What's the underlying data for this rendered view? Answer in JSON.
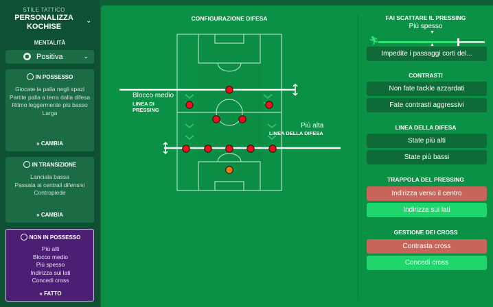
{
  "sidebar": {
    "style_label": "STILE TATTICO",
    "style_name": "PERSONALIZZA KOCHISE",
    "mentality_title": "MENTALITÀ",
    "mentality_value": "Positiva",
    "in_possession": {
      "title": "IN POSSESSO",
      "items": [
        "Giocate la palla negli spazi",
        "Partite palla a terra dalla difesa",
        "Ritmo leggermente più basso",
        "Larga"
      ],
      "button": "CAMBIA"
    },
    "in_transition": {
      "title": "IN TRANSIZIONE",
      "items": [
        "Lanciala bassa",
        "Passala ai centrali difensivi",
        "Contropiede"
      ],
      "button": "CAMBIA"
    },
    "out_of_possession": {
      "title": "NON IN POSSESSO",
      "items": [
        "Più alti",
        "Blocco medio",
        "Più spesso",
        "Indirizza sui lati",
        "Concedi cross"
      ],
      "button": "FATTO"
    }
  },
  "defense": {
    "title": "CONFIGURAZIONE DIFESA",
    "pressing_block_label": "Blocco medio",
    "pressing_line_label": "LINEA DI PRESSING",
    "defense_height_label": "Più alta",
    "defense_line_label": "LINEA DELLA DIFESA"
  },
  "right": {
    "pressing_title": "FAI SCATTARE IL PRESSING",
    "pressing_value": "Più spesso",
    "pressing_level": 0.75,
    "pressing_option": "Impedite i passaggi corti del...",
    "tackles_title": "CONTRASTI",
    "tackles_options": [
      "Non fate tackle azzardati",
      "Fate contrasti aggressivi"
    ],
    "defline_title": "LINEA DELLA DIFESA",
    "defline_options": [
      "State più alti",
      "State più bassi"
    ],
    "trap_title": "TRAPPOLA DEL PRESSING",
    "trap_options": [
      "Indirizza verso il centro",
      "Indirizza sui lati"
    ],
    "cross_title": "GESTIONE DEI CROSS",
    "cross_options": [
      "Contrasta cross",
      "Concedi cross"
    ]
  },
  "colors": {
    "player": "#e8101a",
    "goalkeeper": "#f07a14",
    "selected_option": "#1ed66c",
    "rejected_option": "#c8655a",
    "non_in_possesso_panel": "#4c1e74"
  }
}
